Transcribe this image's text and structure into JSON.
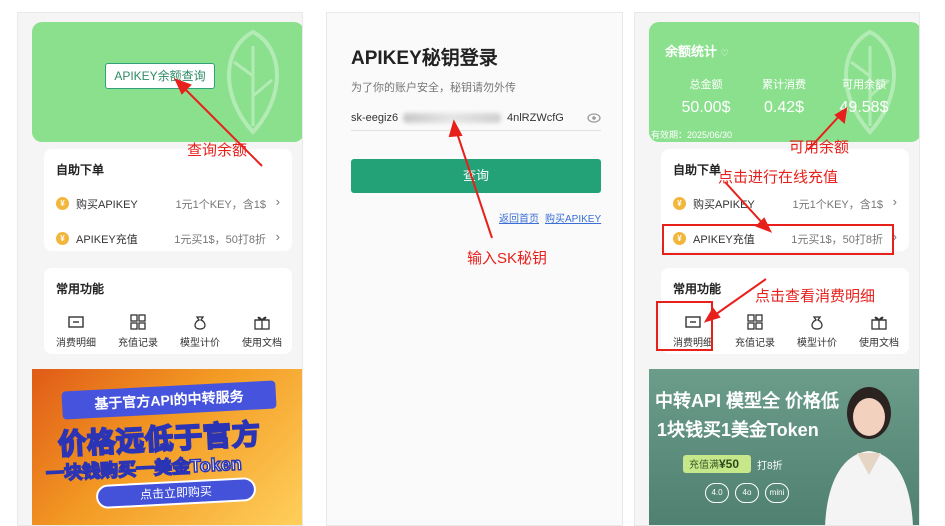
{
  "panel1": {
    "query_button": "APIKEY余额查询",
    "self_order": {
      "title": "自助下单",
      "items": [
        {
          "label": "购买APIKEY",
          "value": "1元1个KEY，含1$"
        },
        {
          "label": "APIKEY充值",
          "value": "1元买1$，50打8折"
        }
      ]
    },
    "common": {
      "title": "常用功能",
      "items": [
        "消费明细",
        "充值记录",
        "模型计价",
        "使用文档"
      ]
    },
    "banner": {
      "ribbon": "基于官方API的中转服务",
      "line1": "价格远低于官方",
      "line2": "一块钱购买一美金Token",
      "button": "点击立即购买"
    }
  },
  "panel2": {
    "title": "APIKEY秘钥登录",
    "subtitle": "为了你的账户安全，秘钥请勿外传",
    "key_prefix": "sk-eegiz6",
    "key_suffix": "4nlRZWcfG",
    "submit": "查询",
    "links": [
      "返回首页",
      "购买APIKEY"
    ]
  },
  "panel3": {
    "title": "余额统计",
    "stats": [
      {
        "label": "总金额",
        "value": "50.00$"
      },
      {
        "label": "累计消费",
        "value": "0.42$"
      },
      {
        "label": "可用余额",
        "value": "49.58$"
      }
    ],
    "valid": "有效期：2025/06/30",
    "banner": {
      "line1": "中转API 模型全 价格低",
      "line2": "1块钱买1美金Token",
      "recharge_prefix": "充值满",
      "recharge_amount": "¥50",
      "discount": "打8折",
      "pills": [
        "4.0",
        "4o",
        "mini"
      ]
    }
  },
  "annotations": {
    "query_balance": "查询余额",
    "input_sk": "输入SK秘钥",
    "available_balance": "可用余额",
    "click_recharge": "点击进行在线充值",
    "click_detail": "点击查看消费明细"
  },
  "colors": {
    "green_card": "#8be08e",
    "primary": "#23a278",
    "annotation": "#e8201c",
    "coin": "#f2b63c"
  }
}
